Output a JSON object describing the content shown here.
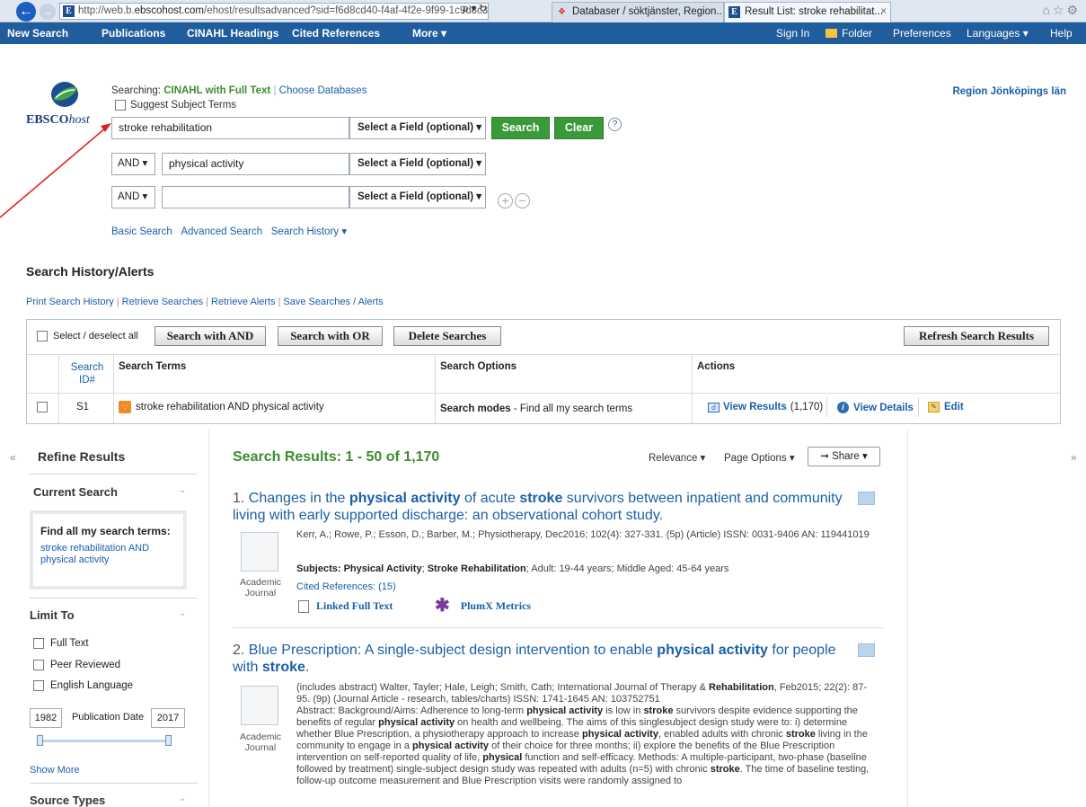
{
  "browser": {
    "url_prefix": "http://web.b.",
    "url_domain": "ebscohost.com",
    "url_suffix": "/ehost/resultsadvanced?sid=f6d8cd40-f4af-4f2e-9f99-1c9d8c32",
    "url_tools": "ρ ▾ ↻",
    "tab1": "Databaser / söktjänster, Region...",
    "tab2": "Result List: stroke rehabilitat...",
    "tab_close": "×",
    "favicon_letter": "E"
  },
  "toolbar": {
    "new_search": "New Search",
    "publications": "Publications",
    "cinahl_headings": "CINAHL Headings",
    "cited_references": "Cited References",
    "more": "More ▾",
    "sign_in": "Sign In",
    "folder": "Folder",
    "preferences": "Preferences",
    "languages": "Languages ▾",
    "help": "Help"
  },
  "header": {
    "logo_bold": "EBSCO",
    "logo_italic": "host",
    "searching_label": "Searching:",
    "database": "CINAHL with Full Text",
    "choose_databases": "Choose Databases",
    "suggest_subject_terms": "Suggest Subject Terms",
    "institution": "Region Jönköpings län"
  },
  "search": {
    "row1_value": "stroke rehabilitation",
    "row2_value": "physical activity",
    "row3_value": "",
    "field_select": "Select a Field (optional) ▾",
    "bool_op": "AND ▾",
    "search_button": "Search",
    "clear_button": "Clear",
    "help": "?",
    "basic_search": "Basic Search",
    "advanced_search": "Advanced Search",
    "search_history": "Search History ▾"
  },
  "history": {
    "title": "Search History/Alerts",
    "links": [
      "Print Search History",
      "Retrieve Searches",
      "Retrieve Alerts",
      "Save Searches / Alerts"
    ],
    "select_all": "Select / deselect all",
    "search_with_and": "Search with AND",
    "search_with_or": "Search with OR",
    "delete_searches": "Delete Searches",
    "refresh": "Refresh Search Results",
    "col_id": "Search ID#",
    "col_terms": "Search Terms",
    "col_options": "Search Options",
    "col_actions": "Actions",
    "row": {
      "id": "S1",
      "terms": "stroke rehabilitation AND physical activity",
      "options_bold": "Search modes",
      "options_rest": " - Find all my search terms",
      "view_results": "View Results",
      "count": "(1,170)",
      "view_details": "View Details",
      "edit": "Edit"
    }
  },
  "refine": {
    "title": "Refine Results",
    "current_search": "Current Search",
    "find_all": "Find all my search terms:",
    "current_terms": "stroke rehabilitation AND physical activity",
    "limit_to": "Limit To",
    "limits": [
      "Full Text",
      "Peer Reviewed",
      "English Language"
    ],
    "year_from": "1982",
    "pub_date": "Publication Date",
    "year_to": "2017",
    "show_more": "Show More",
    "source_types": "Source Types"
  },
  "results": {
    "heading": "Search Results: 1 - 50 of 1,170",
    "relevance": "Relevance ▾",
    "page_options": "Page Options ▾",
    "share": "Share ▾",
    "items": [
      {
        "num": "1.",
        "type": "Academic Journal",
        "meta": "Kerr, A.; Rowe, P.; Esson, D.; Barber, M.; Physiotherapy, Dec2016; 102(4): 327-331. (5p) (Article) ISSN: 0031-9406 AN: 119441019",
        "cited": "Cited References: (15)",
        "linked_full_text": "Linked Full Text",
        "plumx": "PlumX Metrics"
      },
      {
        "num": "2.",
        "type": "Academic Journal"
      }
    ]
  }
}
